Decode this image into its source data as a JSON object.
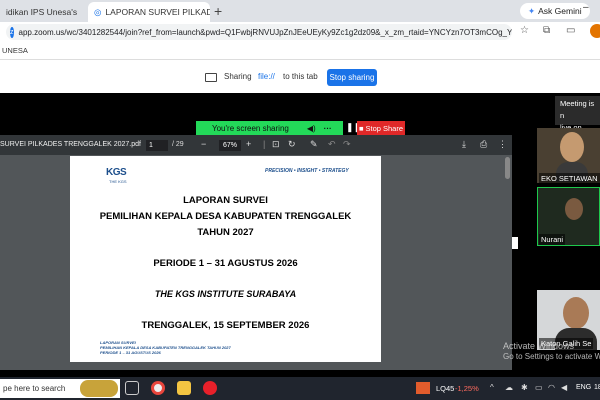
{
  "browser": {
    "tabs": [
      {
        "label": "idikan IPS Unesa's"
      },
      {
        "label": "LAPORAN SURVEI PILKADE"
      }
    ],
    "new_tab_icon": "+",
    "gemini_label": "Ask Gemini",
    "url": "app.zoom.us/wc/3401282544/join?ref_from=launch&pwd=Q1FwbjRNVUJpZnJEeUEyKy9Zc1g2dz09&_x_zm_rtaid=YNCYzn7OT3mCOg_YBvKUFg.1789...",
    "bookmark": "UNESA"
  },
  "sharebar": {
    "sharing": "Sharing",
    "file": "file://",
    "to_this_tab": "to this tab",
    "stop_sharing": "Stop sharing"
  },
  "zoom": {
    "screen_sharing": "You're screen sharing",
    "more": "···",
    "stop_share": "Stop Share",
    "meeting_tip_line1": "Meeting is n",
    "meeting_tip_line2": "live on YouT",
    "participants": [
      {
        "name": "EKO SETIAWAN"
      },
      {
        "name": "Nurani"
      },
      {
        "name": "Katon Galih Se"
      }
    ]
  },
  "pdf": {
    "title": "SURVEI PILKADES TRENGGALEK 2027.pdf",
    "page": "1",
    "total": "/ 29",
    "zoom": "67%",
    "logo": "KGS",
    "logo_sub": "THE KGS",
    "tagline": "PRECISION • INSIGHT • STRATEGY",
    "line1": "LAPORAN SURVEI",
    "line2": "PEMILIHAN KEPALA DESA KABUPATEN TRENGGALEK",
    "line3": "TAHUN 2027",
    "period": "PERIODE 1 – 31 AGUSTUS 2026",
    "institute": "THE KGS INSTITUTE SURABAYA",
    "date": "TRENGGALEK, 15 SEPTEMBER 2026",
    "footer1": "LAPORAN SURVEI",
    "footer2": "PEMILIHAN KEPALA DESA KABUPATEN TRENGGALEK TAHUN 2027",
    "footer3": "PERIODE 1 – 31 AGUSTUS 2026"
  },
  "windows": {
    "activate_title": "Activate Windows",
    "activate_sub": "Go to Settings to activate Windows.",
    "search_placeholder": "pe here to search",
    "stock_name": "LQ45",
    "stock_change": "-1,25%",
    "language": "ENG",
    "clock": "18"
  },
  "colors": {
    "zoom_blue": "#1a73e8",
    "share_green": "#23d959",
    "stop_red": "#e02828"
  }
}
